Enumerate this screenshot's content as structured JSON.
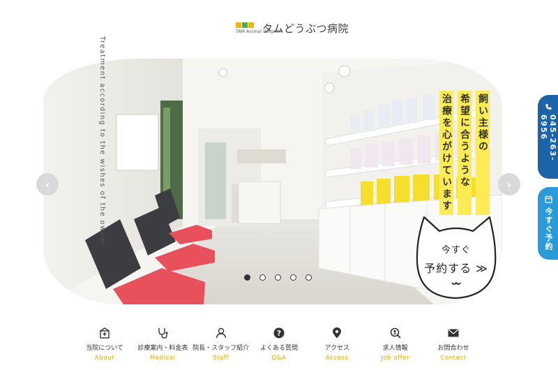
{
  "logo": {
    "small_text": "TAM Animal Hospital",
    "name": "タムどうぶつ病院",
    "square_colors": [
      "#f4b400",
      "#4caf50",
      "#f4b400"
    ]
  },
  "hero": {
    "copy_jp": [
      "飼い主様の",
      "希望に合うような",
      "治療を心がけています"
    ],
    "copy_en": "Treatment according to the wishes of the owner",
    "prev_icon": "chevron-left-icon",
    "next_icon": "chevron-right-icon",
    "slide_count": 5,
    "active_slide": 1
  },
  "reserve_badge": {
    "line1": "今すぐ",
    "line2": "予約する ≫"
  },
  "side": {
    "phone": "045-263-6956",
    "reserve": "今すぐ予約",
    "phone_icon": "phone-icon",
    "calendar_icon": "calendar-icon"
  },
  "nav": [
    {
      "jp": "当院について",
      "en": "About",
      "icon": "hospital-icon"
    },
    {
      "jp": "診療案内・料金表",
      "en": "Medical",
      "icon": "stethoscope-icon"
    },
    {
      "jp": "院長・スタッフ紹介",
      "en": "Staff",
      "icon": "person-icon"
    },
    {
      "jp": "よくある質問",
      "en": "Q&A",
      "icon": "question-icon"
    },
    {
      "jp": "アクセス",
      "en": "Access",
      "icon": "map-pin-icon"
    },
    {
      "jp": "求人情報",
      "en": "Job offer",
      "icon": "search-person-icon"
    },
    {
      "jp": "お問合わせ",
      "en": "Contact",
      "icon": "mail-icon"
    }
  ],
  "colors": {
    "accent_yellow": "#fbec53",
    "nav_english": "#e7a500",
    "phone_blue": "#1c64a9",
    "reserve_blue": "#2a9bd9",
    "chair_red": "#e8505b"
  }
}
